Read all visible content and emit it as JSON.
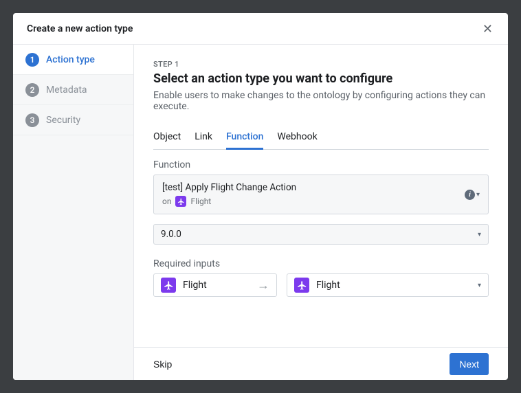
{
  "modal": {
    "title": "Create a new action type"
  },
  "sidebar": {
    "items": [
      {
        "num": "1",
        "label": "Action type",
        "active": true
      },
      {
        "num": "2",
        "label": "Metadata",
        "active": false
      },
      {
        "num": "3",
        "label": "Security",
        "active": false
      }
    ]
  },
  "content": {
    "step": "STEP 1",
    "heading": "Select an action type you want to configure",
    "subtitle": "Enable users to make changes to the ontology by configuring actions they can execute.",
    "tabs": [
      {
        "label": "Object",
        "active": false
      },
      {
        "label": "Link",
        "active": false
      },
      {
        "label": "Function",
        "active": true
      },
      {
        "label": "Webhook",
        "active": false
      }
    ],
    "function_label": "Function",
    "function_name": "[test] Apply Flight Change Action",
    "function_on_prefix": "on",
    "function_on_object": "Flight",
    "version": "9.0.0",
    "required_inputs_label": "Required inputs",
    "input_source": "Flight",
    "input_target": "Flight"
  },
  "footer": {
    "skip": "Skip",
    "next": "Next"
  }
}
